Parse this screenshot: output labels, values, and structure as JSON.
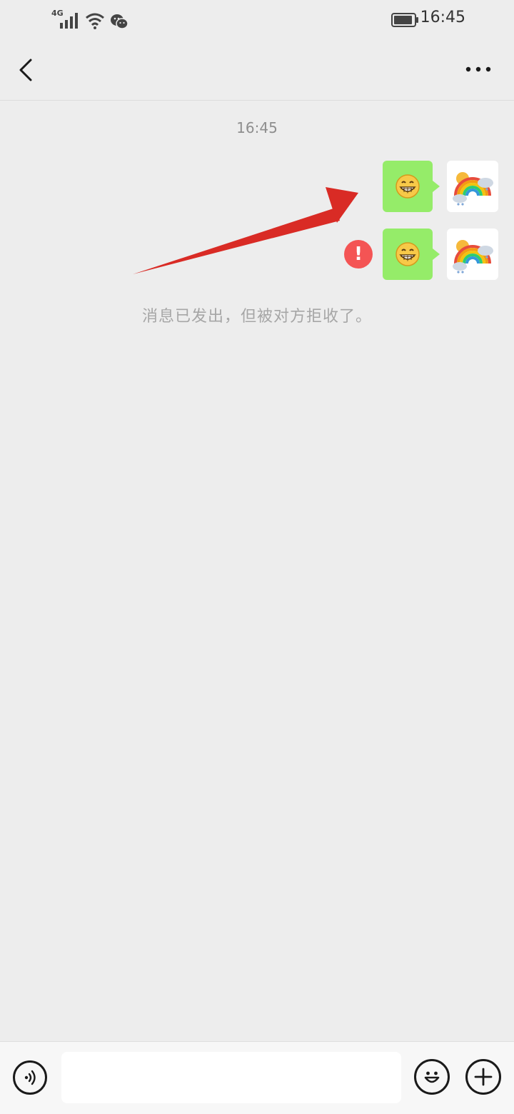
{
  "status_bar": {
    "network_type": "4G",
    "time": "16:45",
    "icons": [
      "signal-icon",
      "wifi-icon",
      "wechat-icon",
      "battery-icon"
    ]
  },
  "header": {
    "back_icon": "chevron-left-icon",
    "contact_name": "",
    "more_icon": "more-dots-icon"
  },
  "chat": {
    "timestamp": "16:45",
    "messages": [
      {
        "type": "emoji",
        "emoji": "grinning-face",
        "sent_by_me": true,
        "failed": false,
        "avatar": "rainbow-avatar"
      },
      {
        "type": "emoji",
        "emoji": "grinning-face",
        "sent_by_me": true,
        "failed": true,
        "error_mark": "!",
        "avatar": "rainbow-avatar"
      }
    ],
    "system_notice": "消息已发出，但被对方拒收了。"
  },
  "input_bar": {
    "input_value": "",
    "icons": [
      "voice-icon",
      "emoji-icon",
      "plus-icon"
    ]
  },
  "colors": {
    "background": "#ededed",
    "bubble_green": "#95ec69",
    "error_red": "#f45454",
    "annotation_arrow": "#d92b25"
  }
}
